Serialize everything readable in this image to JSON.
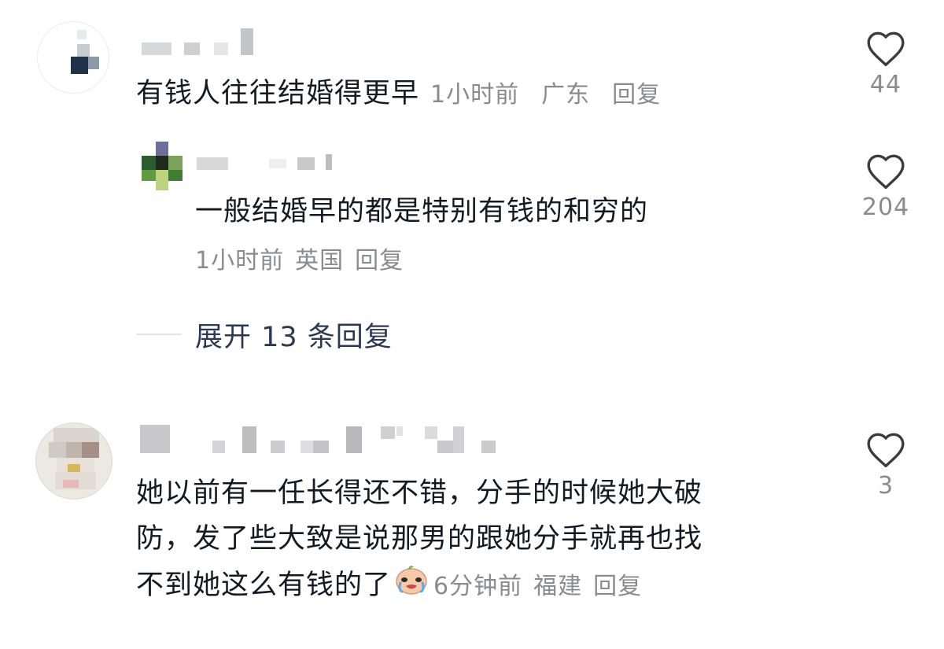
{
  "comments": [
    {
      "text": "有钱人往往结婚得更早",
      "time": "1小时前",
      "location": "广东",
      "reply": "回复",
      "likes": "44"
    },
    {
      "text": "一般结婚早的都是特别有钱的和穷的",
      "time": "1小时前",
      "location": "英国",
      "reply": "回复",
      "likes": "204"
    },
    {
      "lines": [
        "她以前有一任长得还不错，分手的时候她大破",
        "防，发了些大致是说那男的跟她分手就再也找",
        "不到她这么有钱的了"
      ],
      "emoji": "crying-face-emoji",
      "time": "6分钟前",
      "location": "福建",
      "reply": "回复",
      "likes": "3"
    }
  ],
  "expand_replies": "展开 13 条回复",
  "colors": {
    "text": "#161823",
    "meta": "#8a8b91",
    "expand": "#2b3955"
  },
  "icons": {
    "like": "heart-outline-icon"
  }
}
